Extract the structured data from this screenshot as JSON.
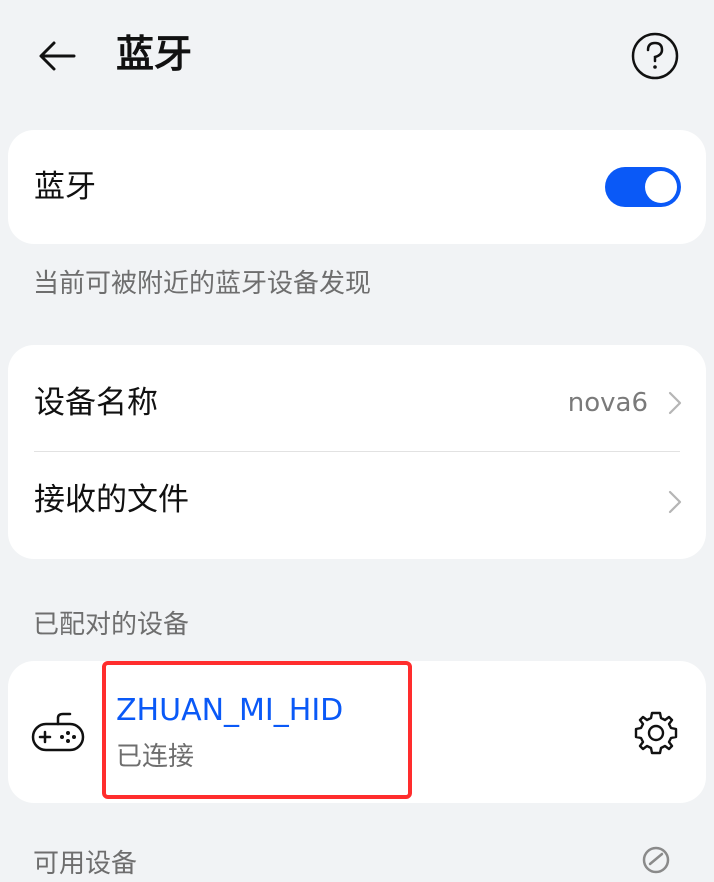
{
  "header": {
    "title": "蓝牙",
    "back_icon": "arrow-left-icon",
    "help_icon": "question-circle-icon"
  },
  "bluetooth_card": {
    "label": "蓝牙",
    "toggle_on": true,
    "toggle_color": "#0a59f7"
  },
  "visibility_hint": "当前可被附近的蓝牙设备发现",
  "device_card": {
    "device_name_label": "设备名称",
    "device_name_value": "nova6",
    "received_files_label": "接收的文件"
  },
  "paired_section": {
    "label": "已配对的设备",
    "devices": [
      {
        "name": "ZHUAN_MI_HID",
        "status": "已连接",
        "icon": "gamepad-icon",
        "settings_icon": "gear-icon"
      }
    ]
  },
  "available_section": {
    "label": "可用设备",
    "icon": "loading-spinner-icon"
  },
  "colors": {
    "accent": "#0a59f7",
    "highlight": "#ff2d2d",
    "background": "#f1f3f5"
  }
}
